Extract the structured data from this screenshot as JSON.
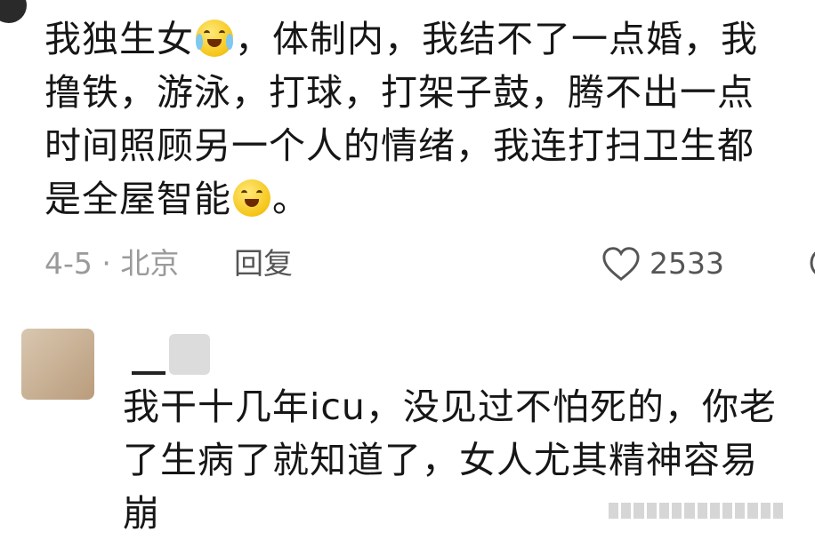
{
  "comment": {
    "line1_a": "我独生女",
    "line1_b": "，体制内，我结不了一点婚，我",
    "line2": "撸铁，游泳，打球，打架子鼓，腾不出一点",
    "line3": "时间照顾另一个人的情绪，我连打扫卫生都",
    "line4_a": "是全屋智能",
    "line4_b": "。",
    "emoji_1": "crying-laugh-emoji",
    "emoji_2": "smile-emoji",
    "date_location": "4-5 · 北京",
    "reply_label": "回复",
    "like_count": "2533"
  },
  "reply": {
    "line1": "我干十几年icu，没见过不怕死的，你老",
    "line2": "了生病了就知道了，女人尤其精神容易",
    "line3": "崩"
  },
  "colors": {
    "text": "#161616",
    "meta": "#9a9a9a",
    "emoji": "#f5c518"
  }
}
